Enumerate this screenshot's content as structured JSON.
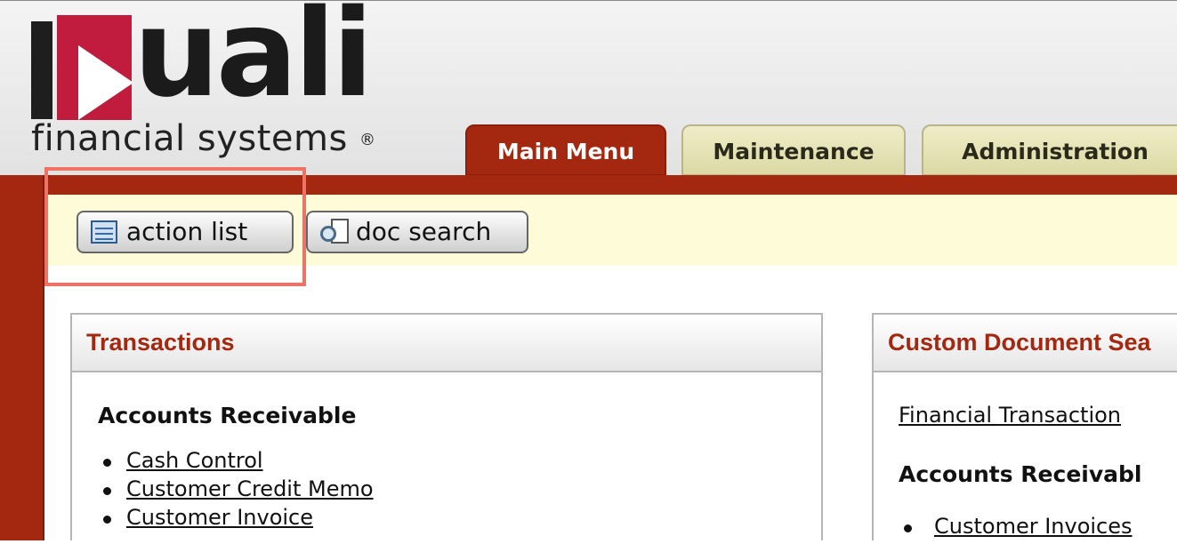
{
  "brand": {
    "logo_text": "uali",
    "tagline": "financial systems",
    "registered": "®"
  },
  "tabs": [
    {
      "label": "Main Menu",
      "active": true
    },
    {
      "label": "Maintenance",
      "active": false
    },
    {
      "label": "Administration",
      "active": false
    }
  ],
  "toolbar": {
    "action_list": "action list",
    "doc_search": "doc search"
  },
  "transactions": {
    "title": "Transactions",
    "section": "Accounts Receivable",
    "links": [
      "Cash Control",
      "Customer Credit Memo",
      "Customer Invoice"
    ]
  },
  "custom_search": {
    "title": "Custom Document Sea",
    "link": "Financial Transaction",
    "section": "Accounts Receivabl",
    "links": [
      "Customer Invoices"
    ]
  },
  "colors": {
    "brand_red": "#a42810",
    "logo_red": "#c11c3d",
    "toolbar_bg": "#fdfbd8",
    "highlight": "#f07264"
  }
}
